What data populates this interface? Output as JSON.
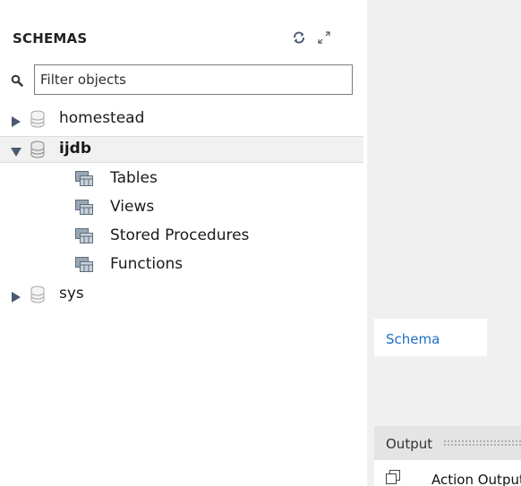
{
  "sidebar": {
    "header": "SCHEMAS",
    "filter_placeholder": "Filter objects",
    "tree": [
      {
        "label": "homestead",
        "expanded": false
      },
      {
        "label": "ijdb",
        "expanded": true,
        "selected": true,
        "children": [
          "Tables",
          "Views",
          "Stored Procedures",
          "Functions"
        ]
      },
      {
        "label": "sys",
        "expanded": false
      }
    ]
  },
  "bottom_tabs": {
    "schema": "Schema"
  },
  "output": {
    "title": "Output",
    "selector_label": "Action Output"
  },
  "colors": {
    "tab_text": "#1f6fc4",
    "panel_bg": "#f0f0f0",
    "selected_row_bg": "#f1f1f1",
    "arrow": "#4a5a70"
  },
  "icons": [
    "refresh-icon",
    "expand-icon",
    "search-icon",
    "database-icon",
    "folder-icon",
    "copy-icon"
  ]
}
